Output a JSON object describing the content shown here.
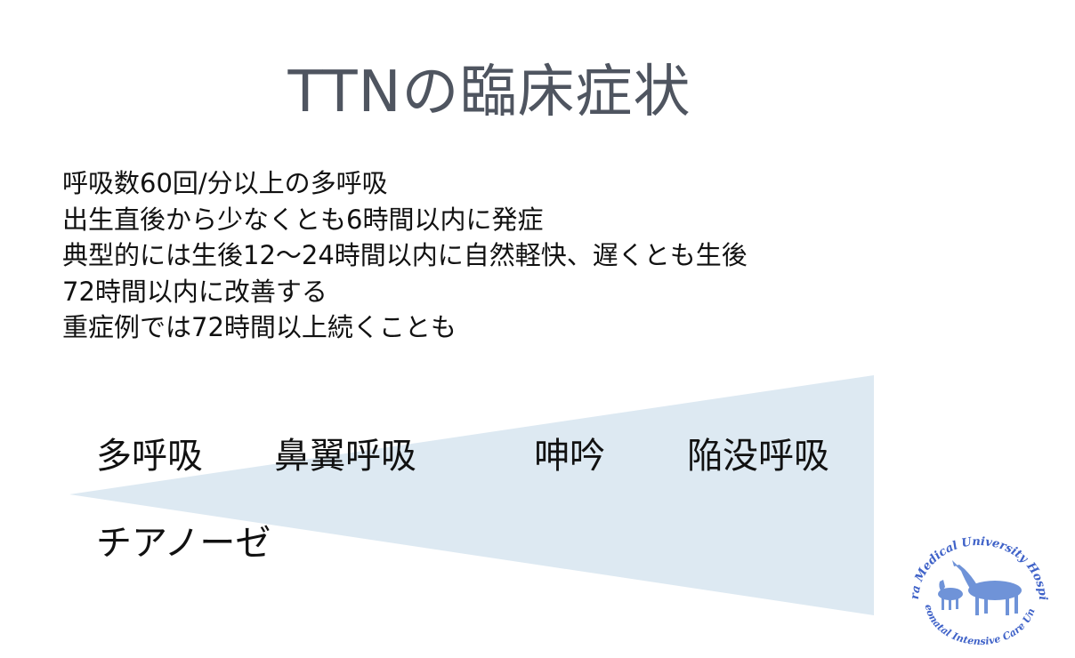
{
  "title": "TTNの臨床症状",
  "bullets": [
    "呼吸数60回/分以上の多呼吸",
    "出生直後から少なくとも6時間以内に発症",
    "典型的には生後12〜24時間以内に自然軽快、遅くとも生後",
    "72時間以内に改善する",
    "重症例では72時間以上続くことも"
  ],
  "symptoms": {
    "tachypnea": "多呼吸",
    "nasal_flaring": "鼻翼呼吸",
    "grunting": "呻吟",
    "retraction": "陥没呼吸",
    "cyanosis": "チアノーゼ"
  },
  "colors": {
    "wedge": "#dde9f2",
    "title": "#4f5560",
    "logo_text": "#3f62c8",
    "logo_deer": "#6f93d8"
  },
  "logo": {
    "top_text": "Nara Medical University Hospital",
    "bottom_text": "Neonatal Intensive Care Unit"
  }
}
